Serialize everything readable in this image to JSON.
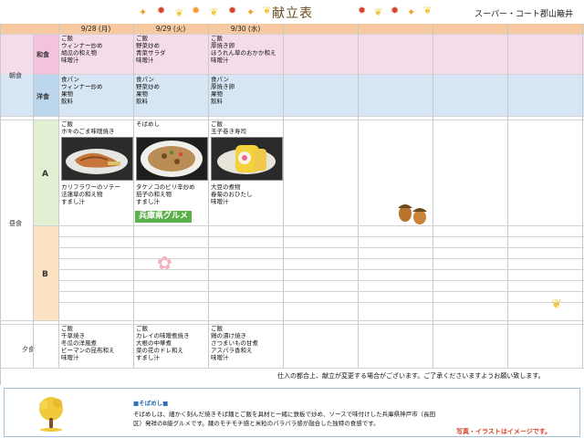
{
  "header": {
    "title": "献立表",
    "store": "スーパー・コート郡山簸井",
    "colors": {
      "leaf_red": "#d8412a",
      "leaf_orange": "#f29a2e",
      "leaf_yellow": "#f0c93a"
    }
  },
  "dates": [
    "9/28 (月)",
    "9/29 (火)",
    "9/30 (水)"
  ],
  "sections": {
    "breakfast": "朝食",
    "lunch": "昼食",
    "dinner": "夕食",
    "washoku": "和食",
    "yoshoku": "洋食",
    "a": "A",
    "b": "B"
  },
  "menu": {
    "washoku": [
      [
        "ご飯",
        "ウィンナー炒め",
        "胡瓜の和え物",
        "味噌汁"
      ],
      [
        "ご飯",
        "野菜炒め",
        "青菜サラダ",
        "味噌汁"
      ],
      [
        "ご飯",
        "厚焼き卵",
        "ほうれん草のおかか和え",
        "味噌汁"
      ]
    ],
    "yoshoku": [
      [
        "食パン",
        "ウィンナー炒め",
        "果物",
        "飲料"
      ],
      [
        "食パン",
        "野菜炒め",
        "果物",
        "飲料"
      ],
      [
        "食パン",
        "厚焼き卵",
        "果物",
        "飲料"
      ]
    ],
    "lunch_a_top": [
      [
        "ご飯",
        "ホキのごま味噌焼き"
      ],
      [
        "そばめし"
      ],
      [
        "ご飯",
        "玉子巻き寿司"
      ]
    ],
    "lunch_a_bottom": [
      [
        "カリフラワーのソテー",
        "法蓮草の和え物",
        "すまし汁"
      ],
      [
        "タケノコのピリ辛炒め",
        "茄子の和え物",
        "すまし汁"
      ],
      [
        "大豆の煮物",
        "春菊のおひたし",
        "味噌汁"
      ]
    ],
    "dinner": [
      [
        "ご飯",
        "千草焼き",
        "冬瓜の洋風煮",
        "ビーマンの昆布和え",
        "味噌汁"
      ],
      [
        "ご飯",
        "カレイの味噌煮焼き",
        "大根の中華煮",
        "菜の花のドレ和え",
        "すまし汁"
      ],
      [
        "ご飯",
        "鶏の漬け焼き",
        "さつまいもの甘煮",
        "アスパラ香和え",
        "味噌汁"
      ]
    ]
  },
  "badge": "兵庫県グルメ",
  "notice": "仕入の都合上、献立が変更する場合がございます。ご了承くださいますようお願い致します。",
  "footer": {
    "heading": "■そばめし■",
    "line1": "そばめしは、細かく刻んだ焼きそば麺とご飯を具材と一緒に鉄板で炒め、ソースで味付けした兵庫県神戸市（長田",
    "line2": "区）発祥のB級グルメです。麺のモチモチ感と米粒のパラパラ感が融合した独特の食感です。",
    "caption": "写真・イラストはイメージです。"
  }
}
